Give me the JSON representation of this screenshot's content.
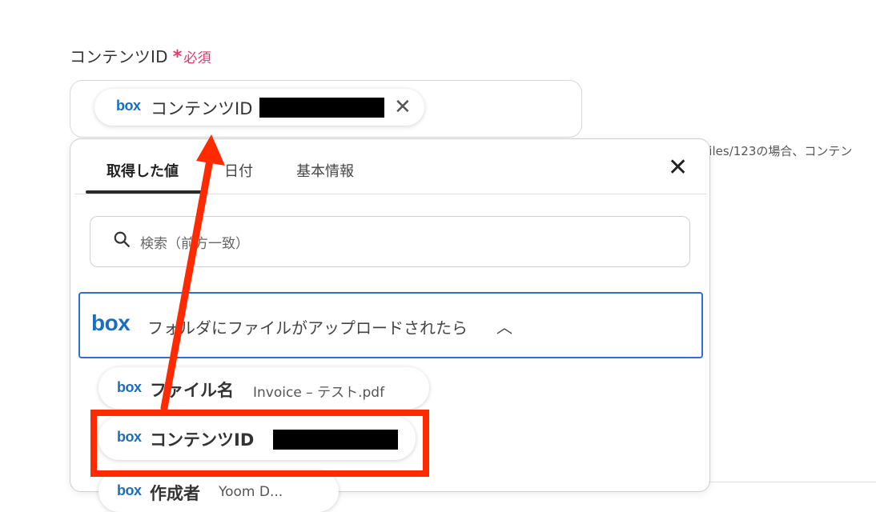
{
  "field": {
    "label": "コンテンツID",
    "required_star": "*",
    "required_text": "必須",
    "chip_label": "コンテンツID"
  },
  "hint_text": "/files/123の場合、コンテン",
  "popup": {
    "tabs": [
      {
        "label": "取得した値"
      },
      {
        "label": "日付"
      },
      {
        "label": "基本情報"
      }
    ],
    "search_placeholder": "検索（前方一致）",
    "group": {
      "logo": "box",
      "label": "フォルダにファイルがアップロードされたら"
    },
    "items": [
      {
        "logo": "box",
        "label": "ファイル名",
        "value": "Invoice – テスト.pdf"
      },
      {
        "logo": "box",
        "label": "コンテンツID",
        "value": ""
      },
      {
        "logo": "box",
        "label": "作成者",
        "value": "Yoom D..."
      }
    ]
  },
  "annotation_color": "#ff2a00",
  "accent_color": "#2f6fd1",
  "icons": [
    "close-icon",
    "search-icon",
    "chevron-up-icon",
    "box-logo"
  ]
}
